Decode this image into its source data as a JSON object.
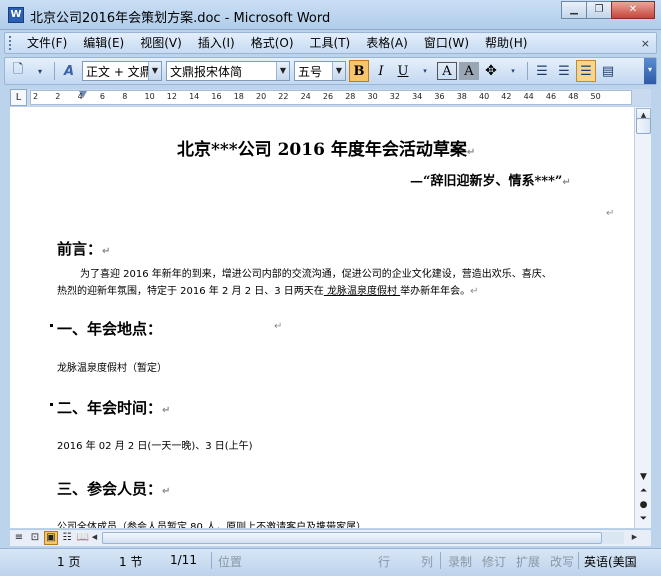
{
  "window": {
    "title": "北京公司2016年会策划方案.doc - Microsoft Word",
    "app_icon": "W",
    "buttons": [
      "minimize-icon",
      "restore-icon",
      "close-icon"
    ]
  },
  "menu": {
    "items": [
      "文件(F)",
      "编辑(E)",
      "视图(V)",
      "插入(I)",
      "格式(O)",
      "工具(T)",
      "表格(A)",
      "窗口(W)",
      "帮助(H)"
    ],
    "close_glyph": "×"
  },
  "toolbar": {
    "style_value": "正文 + 文鼎",
    "font_value": "文鼎报宋体简",
    "size_value": "五号",
    "bold": "B",
    "italic": "I",
    "underline": "U",
    "char_border": "A",
    "char_shading": "A",
    "style_icon_letter": "A",
    "active_buttons": [
      "bold",
      "align-right"
    ]
  },
  "ruler": {
    "ticks": [
      "2",
      "2",
      "4",
      "6",
      "8",
      "10",
      "12",
      "14",
      "16",
      "18",
      "20",
      "22",
      "24",
      "26",
      "28",
      "30",
      "32",
      "34",
      "36",
      "38",
      "40",
      "42",
      "44",
      "46",
      "48",
      "50"
    ],
    "corner": "L"
  },
  "document": {
    "title": "北京***公司 2016 年度年会活动草案",
    "subtitle": "—“辞旧迎新岁、情系***”",
    "preface_heading": "前言：",
    "preface_line1": "为了喜迎 2016 年新年的到来，增进公司内部的交流沟通，促进公司的企业文化建设，营造出欢乐、喜庆、",
    "preface_line2_a": "热烈的迎新年氛围，特定于 2016 年 2 月 2 日、3 日两天在",
    "preface_line2_venue": "  龙脉温泉度假村  ",
    "preface_line2_b": "举办新年年会。",
    "section1_heading": "一、年会地点：",
    "section1_text": "龙脉温泉度假村（暂定）",
    "section2_heading": "二、年会时间：",
    "section2_text": "2016 年 02 月 2 日(一天一晚)、3 日(上午)",
    "section3_heading": "三、参会人员：",
    "section3_text": "公司全体成员（参会人员暂定 80 人，原则上不邀请客户及携带家属）",
    "paragraph_mark": "↵"
  },
  "status": {
    "page": "1 页",
    "section": "1 节",
    "page_of": "1/11",
    "position": "位置",
    "line": "行",
    "column": "列",
    "rec": "录制",
    "trk": "修订",
    "ext": "扩展",
    "ovr": "改写",
    "language": "英语(美国"
  }
}
